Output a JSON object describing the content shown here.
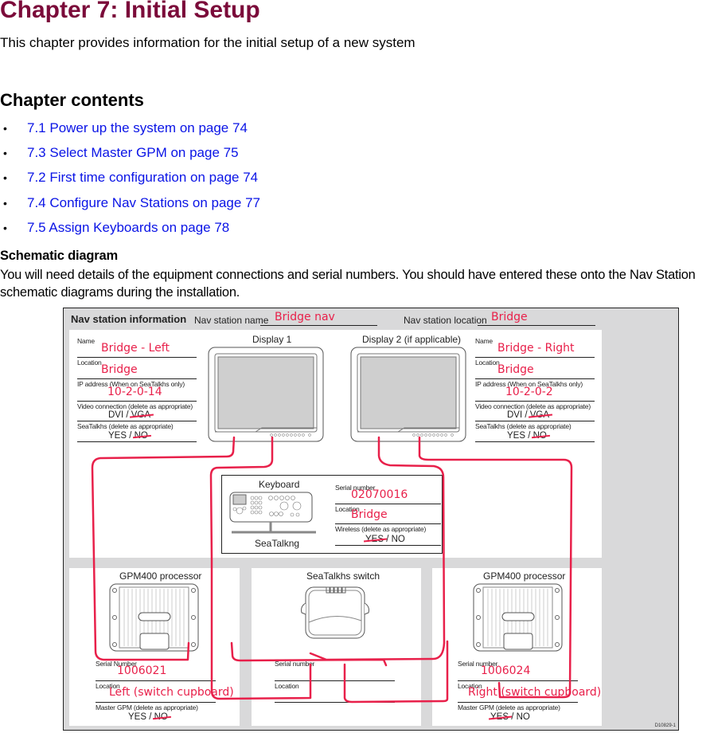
{
  "page": {
    "title": "Chapter 7: Initial Setup",
    "intro": "This chapter provides information for the initial setup of a new system",
    "contents_heading": "Chapter contents",
    "contents": [
      {
        "label": "7.1 Power up the system on page 74"
      },
      {
        "label": "7.3 Select Master GPM on page 75"
      },
      {
        "label": "7.2 First time configuration on page 74"
      },
      {
        "label": "7.4 Configure Nav Stations on page 77"
      },
      {
        "label": "7.5 Assign Keyboards on page 78"
      }
    ],
    "bullet": "•",
    "schematic_heading": "Schematic diagram",
    "schematic_text": "You will need details of the equipment connections and serial numbers. You should have entered these onto the Nav Station schematic diagrams during the installation."
  },
  "diagram": {
    "header": {
      "title": "Nav station information",
      "name_label": "Nav station name",
      "name_value": "Bridge nav",
      "location_label": "Nav station location",
      "location_value": "Bridge"
    },
    "display1": {
      "title": "Display 1",
      "name_label": "Name",
      "name_value": "Bridge - Left",
      "location_label": "Location",
      "location_value": "Bridge",
      "ip_label": "IP address (When on SeaTalkhs only)",
      "ip_value": "10-2-0-14",
      "video_label": "Video connection (delete as appropriate)",
      "video_opt1": "DVI",
      "video_sep": " / ",
      "video_opt2": "VGA",
      "seatalk_label": "SeaTalkhs (delete as appropriate)",
      "seatalk_opt1": "YES",
      "seatalk_sep": " / ",
      "seatalk_opt2": "NO"
    },
    "display2": {
      "title": "Display 2 (if applicable)",
      "name_label": "Name",
      "name_value": "Bridge - Right",
      "location_label": "Location",
      "location_value": "Bridge",
      "ip_label": "IP address (When on SeaTalkhs only)",
      "ip_value": "10-2-0-2",
      "video_label": "Video connection (delete as appropriate)",
      "video_opt1": "DVI",
      "video_sep": " / ",
      "video_opt2": "VGA",
      "seatalk_label": "SeaTalkhs (delete as appropriate)",
      "seatalk_opt1": "YES",
      "seatalk_sep": " / ",
      "seatalk_opt2": "NO"
    },
    "keyboard": {
      "title": "Keyboard",
      "bus_label": "SeaTalkng",
      "serial_label": "Serial number",
      "serial_value": "02070016",
      "location_label": "Location",
      "location_value": "Bridge",
      "wireless_label": "Wireless (delete as appropriate)",
      "wireless_opt1": "YES",
      "wireless_sep": " / ",
      "wireless_opt2": "NO"
    },
    "gpm_left": {
      "title": "GPM400 processor",
      "serial_label": "Serial Number",
      "serial_value": "1006021",
      "location_label": "Location",
      "location_value": "Left (switch cupboard)",
      "master_label": "Master GPM (delete as appropriate)",
      "master_opt1": "YES",
      "master_sep": " / ",
      "master_opt2": "NO"
    },
    "switch": {
      "title": "SeaTalkhs switch",
      "serial_label": "Serial number",
      "location_label": "Location"
    },
    "gpm_right": {
      "title": "GPM400 processor",
      "serial_label": "Serial number",
      "serial_value": "1006024",
      "location_label": "Location",
      "location_value": "Right (switch cupboard)",
      "master_label": "Master GPM (delete as appropriate)",
      "master_opt1": "YES",
      "master_sep": " / ",
      "master_opt2": "NO"
    },
    "reference": "D10829-1",
    "annotation_color": "#e8204a",
    "title_color": "#7b0b3a",
    "link_color": "#0a14e6"
  }
}
